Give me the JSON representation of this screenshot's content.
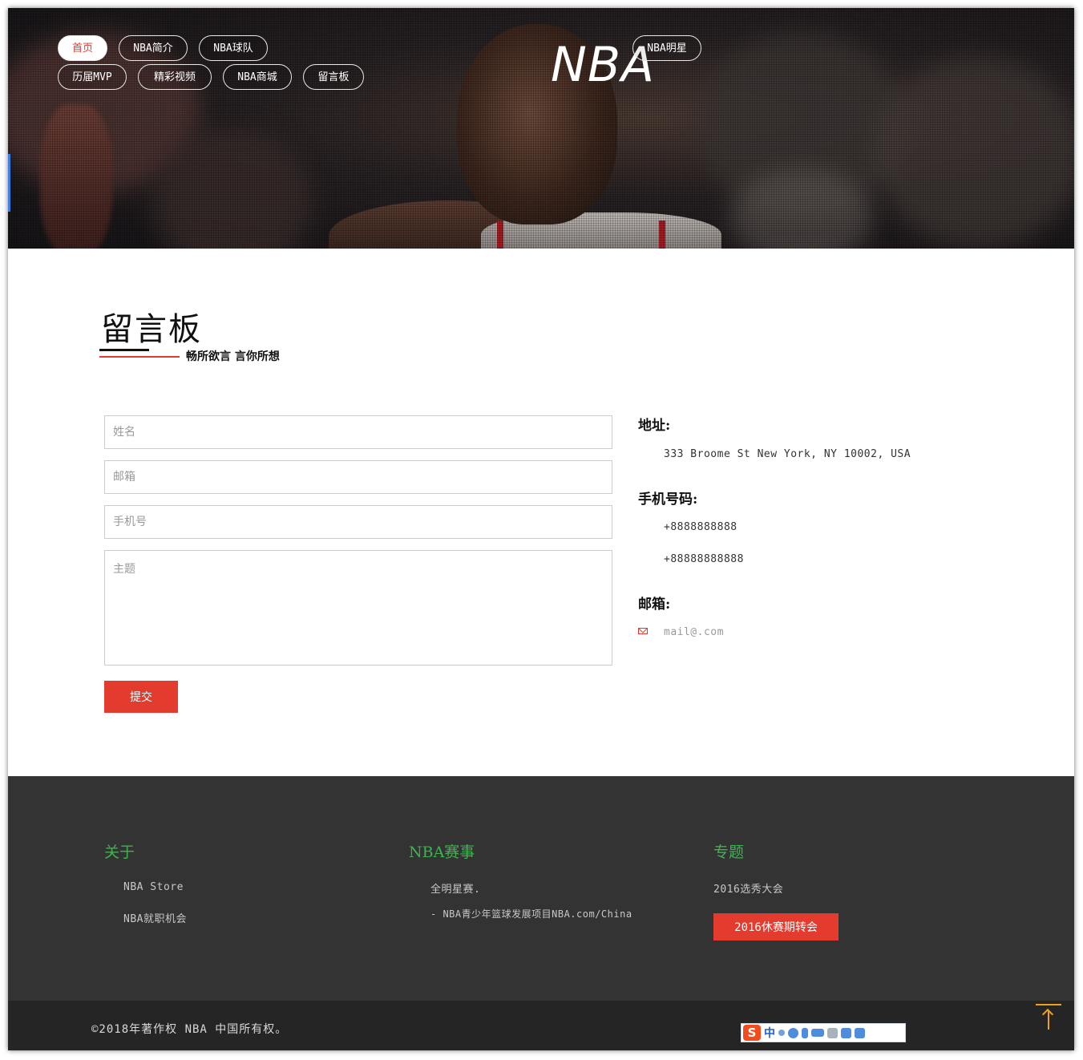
{
  "header": {
    "logo": "NBA",
    "nav": [
      {
        "label": "首页",
        "active": true
      },
      {
        "label": "NBA简介"
      },
      {
        "label": "NBA球队"
      },
      {
        "label": "NBA明星"
      },
      {
        "label": "历届MVP"
      },
      {
        "label": "精彩视频"
      },
      {
        "label": "NBA商城"
      },
      {
        "label": "留言板"
      }
    ]
  },
  "section": {
    "title": "留言板",
    "subtitle": "畅所欲言 言你所想"
  },
  "form": {
    "name_placeholder": "姓名",
    "email_placeholder": "邮箱",
    "phone_placeholder": "手机号",
    "subject_placeholder": "主题",
    "submit_label": "提交"
  },
  "contact": {
    "address_heading": "地址:",
    "address": "333 Broome St New York, NY 10002, USA",
    "phone_heading": "手机号码:",
    "phone_1": "+8888888888",
    "phone_2": "+88888888888",
    "email_heading": "邮箱:",
    "email": "mail@.com",
    "mail_icon": "envelope-icon"
  },
  "footer": {
    "about_heading": "关于",
    "about_links": [
      "NBA Store",
      "NBA就职机会"
    ],
    "events_heading": "NBA赛事",
    "events_links": [
      "全明星赛.",
      "- NBA青少年篮球发展项目NBA.com/China"
    ],
    "topics_heading": "专题",
    "topics_link": "2016选秀大会",
    "topics_button": "2016休赛期转会",
    "copyright": "©2018年著作权 NBA 中国所有权。"
  },
  "ime_toolbar": {
    "logo": "S",
    "mode": "中"
  },
  "colors": {
    "accent": "#e33b2e",
    "footer_heading": "#3fb34f",
    "footer_bg": "#333333",
    "bottom_bg": "#252525",
    "back_to_top": "#f0a11a"
  }
}
